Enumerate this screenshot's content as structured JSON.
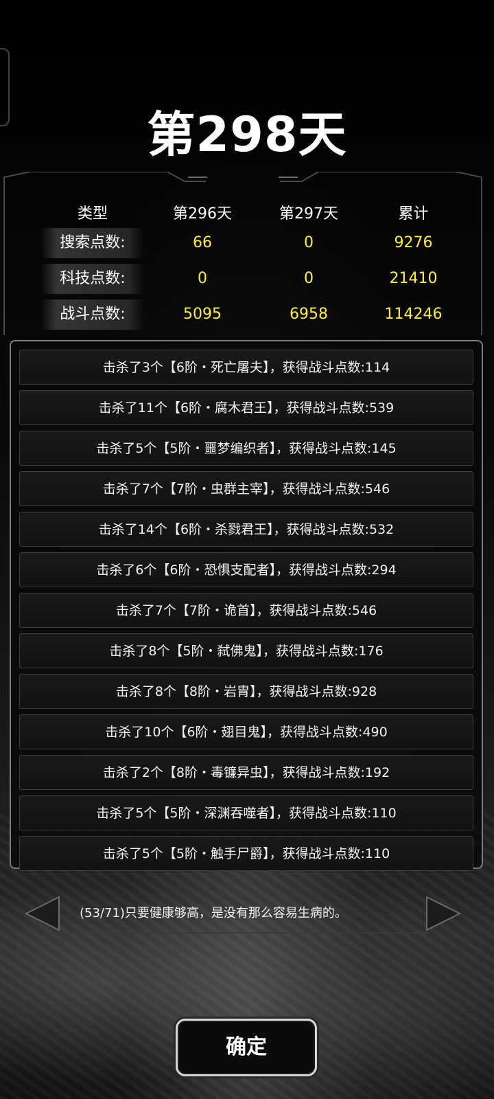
{
  "header": {
    "day_title": "第298天"
  },
  "stats": {
    "columns": [
      "类型",
      "第296天",
      "第297天",
      "累计"
    ],
    "rows": [
      {
        "label": "搜索点数:",
        "day296": "66",
        "day297": "0",
        "total": "9276"
      },
      {
        "label": "科技点数:",
        "day296": "0",
        "day297": "0",
        "total": "21410"
      },
      {
        "label": "战斗点数:",
        "day296": "5095",
        "day297": "6958",
        "total": "114246"
      }
    ]
  },
  "kills": [
    "击杀了3个【6阶・死亡屠夫】，获得战斗点数:114",
    "击杀了11个【6阶・腐木君王】，获得战斗点数:539",
    "击杀了5个【5阶・噩梦编织者】，获得战斗点数:145",
    "击杀了7个【7阶・虫群主宰】，获得战斗点数:546",
    "击杀了14个【6阶・杀戮君王】，获得战斗点数:532",
    "击杀了6个【6阶・恐惧支配者】，获得战斗点数:294",
    "击杀了7个【7阶・诡首】，获得战斗点数:546",
    "击杀了8个【5阶・弑佛鬼】，获得战斗点数:176",
    "击杀了8个【8阶・岩胄】，获得战斗点数:928",
    "击杀了10个【6阶・翅目鬼】，获得战斗点数:490",
    "击杀了2个【8阶・毒镰异虫】，获得战斗点数:192",
    "击杀了5个【5阶・深渊吞噬者】，获得战斗点数:110",
    "击杀了5个【5阶・触手尸爵】，获得战斗点数:110"
  ],
  "tip": {
    "text": "(53/71)只要健康够高，是没有那么容易生病的。"
  },
  "confirm": {
    "label": "确定"
  },
  "colors": {
    "value_yellow": "#ffef3a",
    "panel_border": "#7d7d7d"
  }
}
